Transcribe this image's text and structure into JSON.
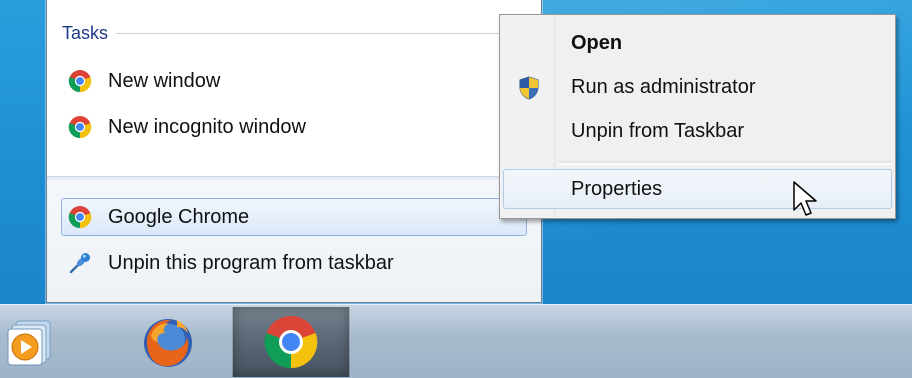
{
  "jumplist": {
    "tasks_title": "Tasks",
    "tasks": [
      {
        "label": "New window",
        "icon": "chrome-icon"
      },
      {
        "label": "New incognito window",
        "icon": "chrome-icon"
      }
    ],
    "pinned_program": {
      "label": "Google Chrome",
      "icon": "chrome-icon"
    },
    "unpin": {
      "label": "Unpin this program from taskbar",
      "icon": "pin-icon"
    }
  },
  "context_menu": {
    "items": [
      {
        "label": "Open",
        "bold": true
      },
      {
        "label": "Run as administrator",
        "icon": "uac-shield-icon"
      },
      {
        "label": "Unpin from Taskbar"
      },
      {
        "label": "Properties",
        "hovered": true
      }
    ]
  },
  "taskbar": {
    "buttons": [
      {
        "name": "Windows Media Player",
        "icon": "media-player-icon"
      },
      {
        "name": "Firefox",
        "icon": "firefox-icon"
      },
      {
        "name": "Google Chrome",
        "icon": "chrome-icon",
        "active": true
      }
    ]
  },
  "colors": {
    "desktop": "#1e8fd3",
    "tasks_title": "#1e3b8a",
    "highlight_border": "#8fb3de",
    "taskbar": "#a9bccf"
  }
}
